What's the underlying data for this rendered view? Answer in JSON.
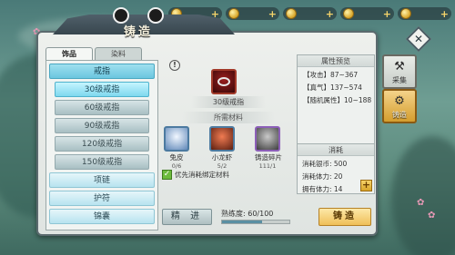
{
  "window": {
    "title": "铸造"
  },
  "topbar": {
    "slots": [
      {
        "icon": "currency-coin-icon",
        "plus": "+"
      },
      {
        "icon": "currency-ingot-icon",
        "plus": "+"
      },
      {
        "icon": "currency-token-icon",
        "plus": "+"
      },
      {
        "icon": "currency-gem-icon",
        "plus": "+"
      },
      {
        "icon": "currency-gold-icon",
        "plus": "+"
      }
    ]
  },
  "tabs": {
    "left": "饰品",
    "right": "染料"
  },
  "list": {
    "items": [
      {
        "label": "戒指",
        "kind": "top"
      },
      {
        "label": "30级戒指",
        "kind": "sub",
        "selected": true
      },
      {
        "label": "60级戒指",
        "kind": "sub"
      },
      {
        "label": "90级戒指",
        "kind": "sub"
      },
      {
        "label": "120级戒指",
        "kind": "sub"
      },
      {
        "label": "150级戒指",
        "kind": "sub"
      },
      {
        "label": "项链",
        "kind": "main"
      },
      {
        "label": "护符",
        "kind": "main"
      },
      {
        "label": "锦囊",
        "kind": "main"
      }
    ]
  },
  "center": {
    "info_icon": "!",
    "product_name": "30级戒指",
    "materials_title": "所需材料",
    "materials": [
      {
        "name": "兔皮",
        "count": "0/6",
        "icon": "rabbit-fur-icon"
      },
      {
        "name": "小龙虾",
        "count": "5/2",
        "icon": "crayfish-icon"
      },
      {
        "name": "铸造碎片",
        "count": "111/1",
        "icon": "forge-fragment-icon"
      }
    ],
    "bind_checkbox": "优先消耗绑定材料"
  },
  "stats": {
    "header": "属性预览",
    "lines": [
      "【攻击】87~367",
      "【真气】137~574",
      "【随机属性】10~188"
    ]
  },
  "cost": {
    "header": "消耗",
    "lines": [
      "消耗银币: 500",
      "消耗体力: 20",
      "拥有体力: 14"
    ],
    "plus": "+"
  },
  "bottom": {
    "refine_label": "精 进",
    "proficiency_label": "熟练度: 60/100",
    "proficiency_progress": 0.6,
    "forge_label": "铸造"
  },
  "side": {
    "close": "✕",
    "tabs": [
      {
        "label": "采集",
        "icon": "crossed-tools-icon"
      },
      {
        "label": "铸造",
        "icon": "forge-icon"
      }
    ]
  }
}
